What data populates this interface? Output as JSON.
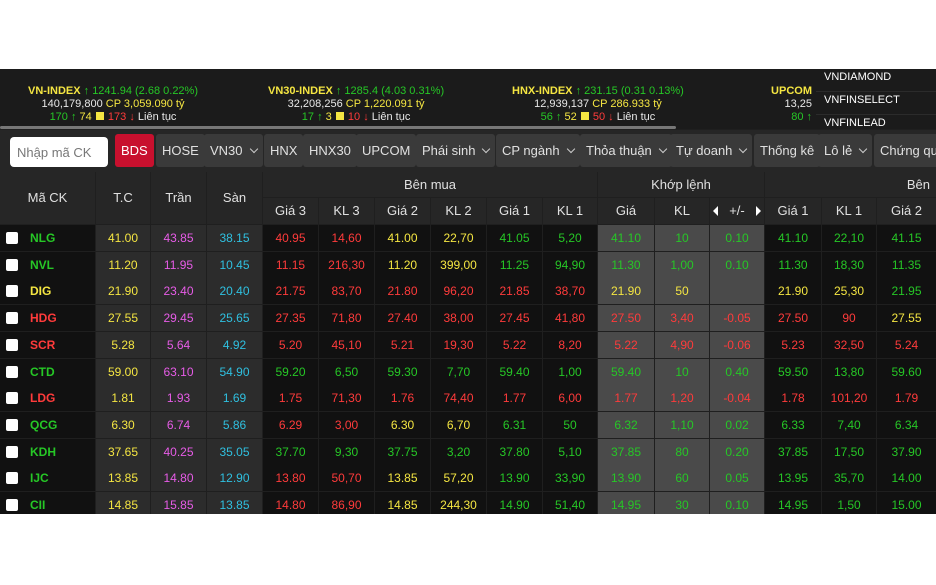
{
  "indices": [
    {
      "name": "VN-INDEX",
      "arrow": "↑",
      "value": "1241.94",
      "change": "(2.68  0.22%)",
      "volume": "140,179,800",
      "cp_label": "CP",
      "cp_value": "3,059.090 tỷ",
      "up": "170",
      "ref": "74",
      "down": "173",
      "status": "Liên tục"
    },
    {
      "name": "VN30-INDEX",
      "arrow": "↑",
      "value": "1285.4",
      "change": "(4.03  0.31%)",
      "volume": "32,208,256",
      "cp_label": "CP",
      "cp_value": "1,220.091 tỷ",
      "up": "17",
      "ref": "3",
      "down": "10",
      "status": "Liên tục"
    },
    {
      "name": "HNX-INDEX",
      "arrow": "↑",
      "value": "231.15",
      "change": "(0.31  0.13%)",
      "volume": "12,939,137",
      "cp_label": "CP",
      "cp_value": "286.933 tỷ",
      "up": "56",
      "ref": "52",
      "down": "50",
      "status": "Liên tục"
    }
  ],
  "upcom": {
    "name": "UPCOM",
    "line2": "13,25",
    "line3": "80 ↑"
  },
  "index_menu": [
    "VNDIAMOND",
    "VNFINSELECT",
    "VNFINLEAD"
  ],
  "search_placeholder": "Nhập mã CK",
  "tabs": [
    {
      "label": "BDS",
      "active": true
    },
    {
      "label": "HOSE"
    },
    {
      "label": "VN30",
      "dropdown": true
    },
    {
      "label": "HNX"
    },
    {
      "label": "HNX30"
    },
    {
      "label": "UPCOM"
    },
    {
      "label": "Phái sinh",
      "dropdown": true
    },
    {
      "label": "CP ngành",
      "dropdown": true
    },
    {
      "label": "Thỏa thuận",
      "dropdown": true
    },
    {
      "label": "Tự doanh",
      "dropdown": true
    },
    {
      "label": "Thống kê"
    },
    {
      "label": "Lô lẻ",
      "dropdown": true
    },
    {
      "label": "Chứng quy"
    }
  ],
  "headers": {
    "symbol": "Mã CK",
    "ref": "T.C",
    "ceil": "Trần",
    "floor": "Sàn",
    "buy_group": "Bên mua",
    "match_group": "Khớp lệnh",
    "sell_group": "Bên",
    "buy": [
      "Giá 3",
      "KL 3",
      "Giá 2",
      "KL 2",
      "Giá 1",
      "KL 1"
    ],
    "match": [
      "Giá",
      "KL",
      "+/-"
    ],
    "sell": [
      "Giá 1",
      "KL 1",
      "Giá 2"
    ]
  },
  "colors": {
    "up": "#26c726",
    "down": "#ff3b3b",
    "ref": "#f5e642",
    "ceil": "#e75ce7",
    "floor": "#2fc0e0"
  },
  "rows": [
    {
      "sym": "NLG",
      "tc": "41.00",
      "tran": "43.85",
      "san": "38.15",
      "b3": [
        "40.95",
        "14,60"
      ],
      "b2": [
        "41.00",
        "22,70"
      ],
      "b1": [
        "41.05",
        "5,20"
      ],
      "m": [
        "41.10",
        "10",
        "0.10"
      ],
      "s1": [
        "41.10",
        "22,10"
      ],
      "s2": "41.15",
      "dir": "up",
      "cb": [
        "dn",
        "dn",
        "ref",
        "ref",
        "up",
        "up"
      ],
      "cs": [
        "up",
        "up",
        "up"
      ]
    },
    {
      "sym": "NVL",
      "tc": "11.20",
      "tran": "11.95",
      "san": "10.45",
      "b3": [
        "11.15",
        "216,30"
      ],
      "b2": [
        "11.20",
        "399,00"
      ],
      "b1": [
        "11.25",
        "94,90"
      ],
      "m": [
        "11.30",
        "1,00",
        "0.10"
      ],
      "s1": [
        "11.30",
        "18,30"
      ],
      "s2": "11.35",
      "dir": "up",
      "cb": [
        "dn",
        "dn",
        "ref",
        "ref",
        "up",
        "up"
      ],
      "cs": [
        "up",
        "up",
        "up"
      ]
    },
    {
      "sym": "DIG",
      "tc": "21.90",
      "tran": "23.40",
      "san": "20.40",
      "b3": [
        "21.75",
        "83,70"
      ],
      "b2": [
        "21.80",
        "96,20"
      ],
      "b1": [
        "21.85",
        "38,70"
      ],
      "m": [
        "21.90",
        "50",
        ""
      ],
      "s1": [
        "21.90",
        "25,30"
      ],
      "s2": "21.95",
      "dir": "ref",
      "cb": [
        "dn",
        "dn",
        "dn",
        "dn",
        "dn",
        "dn"
      ],
      "cs": [
        "ref",
        "ref",
        "up"
      ]
    },
    {
      "sym": "HDG",
      "tc": "27.55",
      "tran": "29.45",
      "san": "25.65",
      "b3": [
        "27.35",
        "71,80"
      ],
      "b2": [
        "27.40",
        "38,00"
      ],
      "b1": [
        "27.45",
        "41,80"
      ],
      "m": [
        "27.50",
        "3,40",
        "-0.05"
      ],
      "s1": [
        "27.50",
        "90"
      ],
      "s2": "27.55",
      "dir": "dn",
      "cb": [
        "dn",
        "dn",
        "dn",
        "dn",
        "dn",
        "dn"
      ],
      "cs": [
        "dn",
        "dn",
        "ref"
      ]
    },
    {
      "sym": "SCR",
      "tc": "5.28",
      "tran": "5.64",
      "san": "4.92",
      "b3": [
        "5.20",
        "45,10"
      ],
      "b2": [
        "5.21",
        "19,30"
      ],
      "b1": [
        "5.22",
        "8,20"
      ],
      "m": [
        "5.22",
        "4,90",
        "-0.06"
      ],
      "s1": [
        "5.23",
        "32,50"
      ],
      "s2": "5.24",
      "dir": "dn",
      "cb": [
        "dn",
        "dn",
        "dn",
        "dn",
        "dn",
        "dn"
      ],
      "cs": [
        "dn",
        "dn",
        "dn"
      ]
    },
    {
      "sym": "CTD",
      "tc": "59.00",
      "tran": "63.10",
      "san": "54.90",
      "b3": [
        "59.20",
        "6,50"
      ],
      "b2": [
        "59.30",
        "7,70"
      ],
      "b1": [
        "59.40",
        "1,00"
      ],
      "m": [
        "59.40",
        "10",
        "0.40"
      ],
      "s1": [
        "59.50",
        "13,80"
      ],
      "s2": "59.60",
      "dir": "up",
      "cb": [
        "up",
        "up",
        "up",
        "up",
        "up",
        "up"
      ],
      "cs": [
        "up",
        "up",
        "up"
      ]
    },
    {
      "sym": "LDG",
      "tc": "1.81",
      "tran": "1.93",
      "san": "1.69",
      "b3": [
        "1.75",
        "71,30"
      ],
      "b2": [
        "1.76",
        "74,40"
      ],
      "b1": [
        "1.77",
        "6,00"
      ],
      "m": [
        "1.77",
        "1,20",
        "-0.04"
      ],
      "s1": [
        "1.78",
        "101,20"
      ],
      "s2": "1.79",
      "dir": "dn",
      "cb": [
        "dn",
        "dn",
        "dn",
        "dn",
        "dn",
        "dn"
      ],
      "cs": [
        "dn",
        "dn",
        "dn"
      ]
    },
    {
      "sym": "QCG",
      "tc": "6.30",
      "tran": "6.74",
      "san": "5.86",
      "b3": [
        "6.29",
        "3,00"
      ],
      "b2": [
        "6.30",
        "6,70"
      ],
      "b1": [
        "6.31",
        "50"
      ],
      "m": [
        "6.32",
        "1,10",
        "0.02"
      ],
      "s1": [
        "6.33",
        "7,40"
      ],
      "s2": "6.34",
      "dir": "up",
      "cb": [
        "dn",
        "dn",
        "ref",
        "ref",
        "up",
        "up"
      ],
      "cs": [
        "up",
        "up",
        "up"
      ]
    },
    {
      "sym": "KDH",
      "tc": "37.65",
      "tran": "40.25",
      "san": "35.05",
      "b3": [
        "37.70",
        "9,30"
      ],
      "b2": [
        "37.75",
        "3,20"
      ],
      "b1": [
        "37.80",
        "5,10"
      ],
      "m": [
        "37.85",
        "80",
        "0.20"
      ],
      "s1": [
        "37.85",
        "17,50"
      ],
      "s2": "37.90",
      "dir": "up",
      "cb": [
        "up",
        "up",
        "up",
        "up",
        "up",
        "up"
      ],
      "cs": [
        "up",
        "up",
        "up"
      ]
    },
    {
      "sym": "IJC",
      "tc": "13.85",
      "tran": "14.80",
      "san": "12.90",
      "b3": [
        "13.80",
        "50,70"
      ],
      "b2": [
        "13.85",
        "57,20"
      ],
      "b1": [
        "13.90",
        "33,90"
      ],
      "m": [
        "13.90",
        "60",
        "0.05"
      ],
      "s1": [
        "13.95",
        "35,70"
      ],
      "s2": "14.00",
      "dir": "up",
      "cb": [
        "dn",
        "dn",
        "ref",
        "ref",
        "up",
        "up"
      ],
      "cs": [
        "up",
        "up",
        "up"
      ]
    },
    {
      "sym": "CII",
      "tc": "14.85",
      "tran": "15.85",
      "san": "13.85",
      "b3": [
        "14.80",
        "86,90"
      ],
      "b2": [
        "14.85",
        "244,30"
      ],
      "b1": [
        "14.90",
        "51,40"
      ],
      "m": [
        "14.95",
        "30",
        "0.10"
      ],
      "s1": [
        "14.95",
        "1,50"
      ],
      "s2": "15.00",
      "dir": "up",
      "cb": [
        "dn",
        "dn",
        "ref",
        "ref",
        "up",
        "up"
      ],
      "cs": [
        "up",
        "up",
        "up"
      ]
    }
  ]
}
